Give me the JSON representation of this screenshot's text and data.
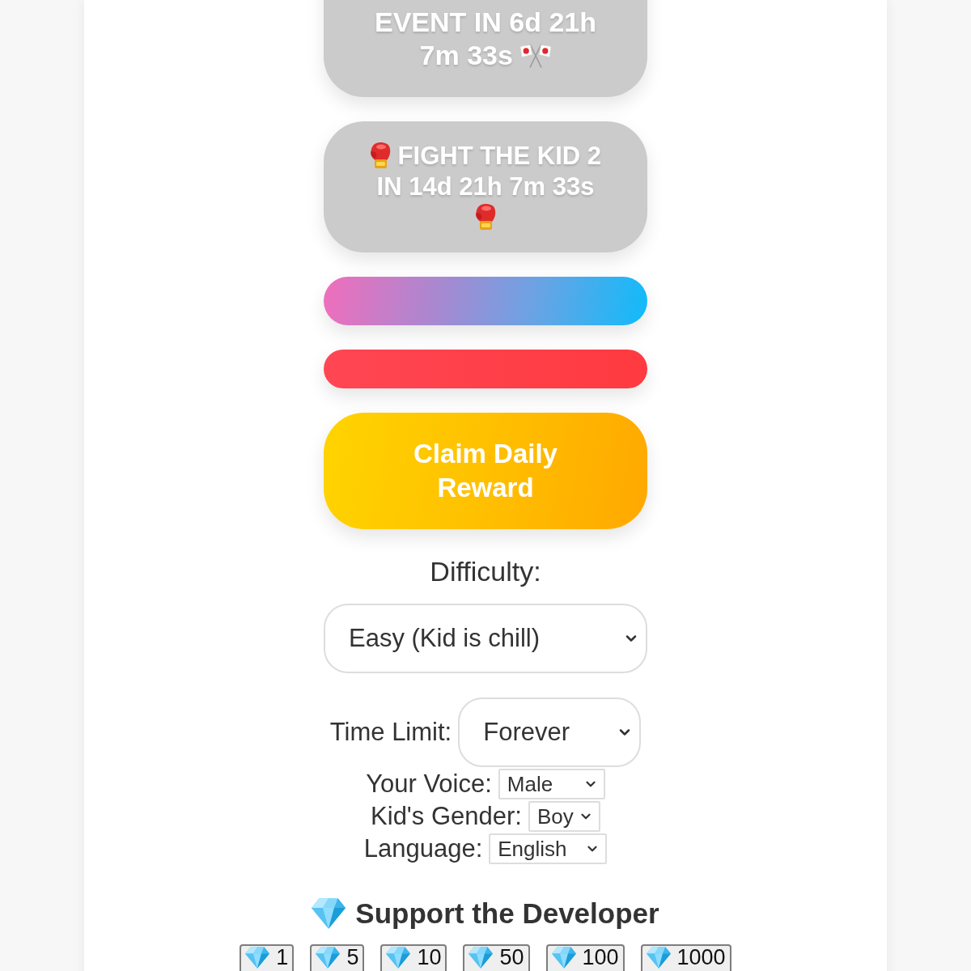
{
  "event_button": {
    "label": "EVENT IN 6d 21h 7m 33s",
    "disabled": true
  },
  "fight_button": {
    "label": "FIGHT THE KID 2 IN 14d 21h 7m 33s",
    "disabled": true
  },
  "blank_buttons": [
    {
      "kind": "gradient"
    },
    {
      "kind": "solid"
    }
  ],
  "claim_button": {
    "label": "Claim Daily Reward"
  },
  "difficulty": {
    "label": "Difficulty:",
    "value": "Easy (Kid is chill)"
  },
  "settings": [
    {
      "kind": "large",
      "label": "Time Limit:",
      "value": "Forever"
    },
    {
      "kind": "compact",
      "label": "Your Voice:",
      "value": "Male"
    },
    {
      "kind": "compact",
      "label": "Kid's Gender:",
      "value": "Boy"
    },
    {
      "kind": "compact",
      "label": "Language:",
      "value": "English"
    }
  ],
  "support": {
    "title": "Support the Developer",
    "buttons": [
      {
        "label": "1"
      },
      {
        "label": "5"
      },
      {
        "label": "10"
      },
      {
        "label": "50"
      },
      {
        "label": "100"
      },
      {
        "label": "1000"
      }
    ]
  }
}
